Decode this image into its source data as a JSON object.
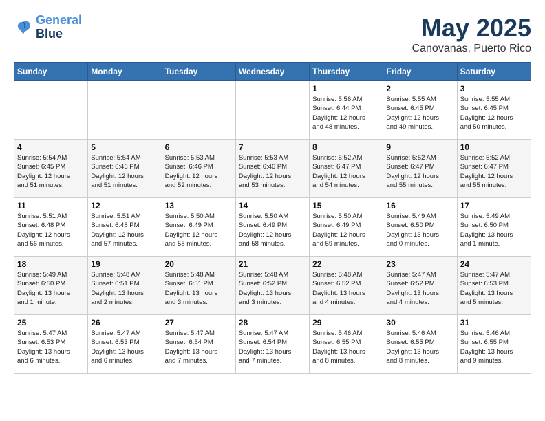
{
  "header": {
    "logo_line1": "General",
    "logo_line2": "Blue",
    "title": "May 2025",
    "subtitle": "Canovanas, Puerto Rico"
  },
  "weekdays": [
    "Sunday",
    "Monday",
    "Tuesday",
    "Wednesday",
    "Thursday",
    "Friday",
    "Saturday"
  ],
  "weeks": [
    [
      {
        "day": "",
        "info": ""
      },
      {
        "day": "",
        "info": ""
      },
      {
        "day": "",
        "info": ""
      },
      {
        "day": "",
        "info": ""
      },
      {
        "day": "1",
        "info": "Sunrise: 5:56 AM\nSunset: 6:44 PM\nDaylight: 12 hours\nand 48 minutes."
      },
      {
        "day": "2",
        "info": "Sunrise: 5:55 AM\nSunset: 6:45 PM\nDaylight: 12 hours\nand 49 minutes."
      },
      {
        "day": "3",
        "info": "Sunrise: 5:55 AM\nSunset: 6:45 PM\nDaylight: 12 hours\nand 50 minutes."
      }
    ],
    [
      {
        "day": "4",
        "info": "Sunrise: 5:54 AM\nSunset: 6:45 PM\nDaylight: 12 hours\nand 51 minutes."
      },
      {
        "day": "5",
        "info": "Sunrise: 5:54 AM\nSunset: 6:46 PM\nDaylight: 12 hours\nand 51 minutes."
      },
      {
        "day": "6",
        "info": "Sunrise: 5:53 AM\nSunset: 6:46 PM\nDaylight: 12 hours\nand 52 minutes."
      },
      {
        "day": "7",
        "info": "Sunrise: 5:53 AM\nSunset: 6:46 PM\nDaylight: 12 hours\nand 53 minutes."
      },
      {
        "day": "8",
        "info": "Sunrise: 5:52 AM\nSunset: 6:47 PM\nDaylight: 12 hours\nand 54 minutes."
      },
      {
        "day": "9",
        "info": "Sunrise: 5:52 AM\nSunset: 6:47 PM\nDaylight: 12 hours\nand 55 minutes."
      },
      {
        "day": "10",
        "info": "Sunrise: 5:52 AM\nSunset: 6:47 PM\nDaylight: 12 hours\nand 55 minutes."
      }
    ],
    [
      {
        "day": "11",
        "info": "Sunrise: 5:51 AM\nSunset: 6:48 PM\nDaylight: 12 hours\nand 56 minutes."
      },
      {
        "day": "12",
        "info": "Sunrise: 5:51 AM\nSunset: 6:48 PM\nDaylight: 12 hours\nand 57 minutes."
      },
      {
        "day": "13",
        "info": "Sunrise: 5:50 AM\nSunset: 6:49 PM\nDaylight: 12 hours\nand 58 minutes."
      },
      {
        "day": "14",
        "info": "Sunrise: 5:50 AM\nSunset: 6:49 PM\nDaylight: 12 hours\nand 58 minutes."
      },
      {
        "day": "15",
        "info": "Sunrise: 5:50 AM\nSunset: 6:49 PM\nDaylight: 12 hours\nand 59 minutes."
      },
      {
        "day": "16",
        "info": "Sunrise: 5:49 AM\nSunset: 6:50 PM\nDaylight: 13 hours\nand 0 minutes."
      },
      {
        "day": "17",
        "info": "Sunrise: 5:49 AM\nSunset: 6:50 PM\nDaylight: 13 hours\nand 1 minute."
      }
    ],
    [
      {
        "day": "18",
        "info": "Sunrise: 5:49 AM\nSunset: 6:50 PM\nDaylight: 13 hours\nand 1 minute."
      },
      {
        "day": "19",
        "info": "Sunrise: 5:48 AM\nSunset: 6:51 PM\nDaylight: 13 hours\nand 2 minutes."
      },
      {
        "day": "20",
        "info": "Sunrise: 5:48 AM\nSunset: 6:51 PM\nDaylight: 13 hours\nand 3 minutes."
      },
      {
        "day": "21",
        "info": "Sunrise: 5:48 AM\nSunset: 6:52 PM\nDaylight: 13 hours\nand 3 minutes."
      },
      {
        "day": "22",
        "info": "Sunrise: 5:48 AM\nSunset: 6:52 PM\nDaylight: 13 hours\nand 4 minutes."
      },
      {
        "day": "23",
        "info": "Sunrise: 5:47 AM\nSunset: 6:52 PM\nDaylight: 13 hours\nand 4 minutes."
      },
      {
        "day": "24",
        "info": "Sunrise: 5:47 AM\nSunset: 6:53 PM\nDaylight: 13 hours\nand 5 minutes."
      }
    ],
    [
      {
        "day": "25",
        "info": "Sunrise: 5:47 AM\nSunset: 6:53 PM\nDaylight: 13 hours\nand 6 minutes."
      },
      {
        "day": "26",
        "info": "Sunrise: 5:47 AM\nSunset: 6:53 PM\nDaylight: 13 hours\nand 6 minutes."
      },
      {
        "day": "27",
        "info": "Sunrise: 5:47 AM\nSunset: 6:54 PM\nDaylight: 13 hours\nand 7 minutes."
      },
      {
        "day": "28",
        "info": "Sunrise: 5:47 AM\nSunset: 6:54 PM\nDaylight: 13 hours\nand 7 minutes."
      },
      {
        "day": "29",
        "info": "Sunrise: 5:46 AM\nSunset: 6:55 PM\nDaylight: 13 hours\nand 8 minutes."
      },
      {
        "day": "30",
        "info": "Sunrise: 5:46 AM\nSunset: 6:55 PM\nDaylight: 13 hours\nand 8 minutes."
      },
      {
        "day": "31",
        "info": "Sunrise: 5:46 AM\nSunset: 6:55 PM\nDaylight: 13 hours\nand 9 minutes."
      }
    ]
  ]
}
